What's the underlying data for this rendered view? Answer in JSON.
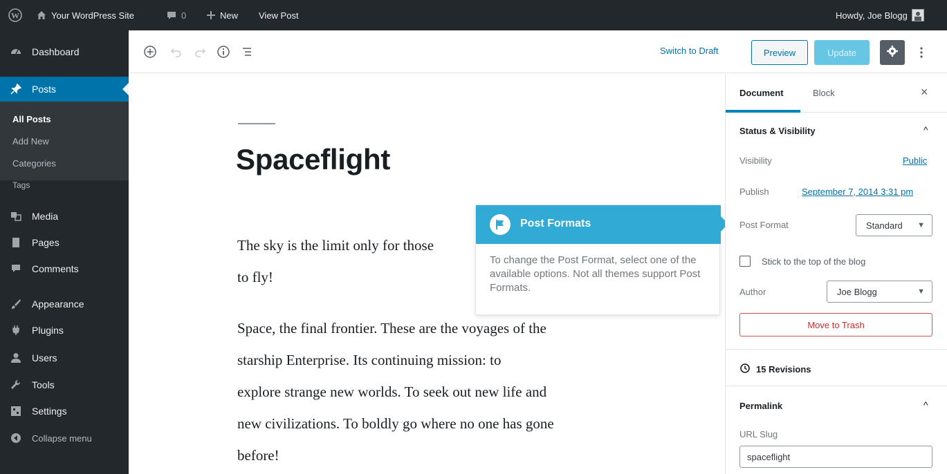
{
  "admin_bar": {
    "site_name": "Your WordPress Site",
    "comments_count": "0",
    "new_label": "New",
    "view_post_label": "View Post",
    "greeting": "Howdy, Joe Blogg"
  },
  "sidebar": {
    "items": [
      {
        "label": "Dashboard",
        "icon": "dashboard-icon"
      },
      {
        "label": "Posts",
        "icon": "pin-icon"
      },
      {
        "label": "Media",
        "icon": "media-icon"
      },
      {
        "label": "Pages",
        "icon": "pages-icon"
      },
      {
        "label": "Comments",
        "icon": "comments-icon"
      },
      {
        "label": "Appearance",
        "icon": "brush-icon"
      },
      {
        "label": "Plugins",
        "icon": "plug-icon"
      },
      {
        "label": "Users",
        "icon": "users-icon"
      },
      {
        "label": "Tools",
        "icon": "wrench-icon"
      },
      {
        "label": "Settings",
        "icon": "settings-icon"
      },
      {
        "label": "Collapse menu",
        "icon": "collapse-icon"
      }
    ],
    "submenu": [
      "All Posts",
      "Add New",
      "Categories",
      "Tags"
    ],
    "accent": "#0073aa"
  },
  "toolbar": {
    "switch_to_draft": "Switch to Draft",
    "preview": "Preview",
    "update": "Update"
  },
  "post": {
    "title": "Spaceflight",
    "paragraph1_line1": "The sky is the limit only for those",
    "paragraph1_line2": "to fly!",
    "paragraph2_lines": [
      "Space, the final frontier. These are the voyages of the",
      "starship Enterprise. Its  continuing mission: to",
      "explore strange new worlds. To seek out new life  and",
      "new civilizations. To boldly go where no one has gone",
      "before!"
    ]
  },
  "popover": {
    "title": "Post Formats",
    "body": "To change the Post Format, select one of the available options. Not all themes support Post Formats.",
    "color": "#31aad6"
  },
  "panel": {
    "tab_document": "Document",
    "tab_block": "Block",
    "status_title": "Status & Visibility",
    "visibility_label": "Visibility",
    "visibility_value": "Public",
    "publish_label": "Publish",
    "publish_value": "September 7, 2014 3:31 pm",
    "post_format_label": "Post Format",
    "post_format_value": "Standard",
    "stick_label": "Stick to the top of the blog",
    "author_label": "Author",
    "author_value": "Joe Blogg",
    "trash_label": "Move to Trash",
    "revisions_label": "15 Revisions",
    "permalink_title": "Permalink",
    "url_slug_label": "URL Slug",
    "url_slug_value": "spaceflight"
  }
}
